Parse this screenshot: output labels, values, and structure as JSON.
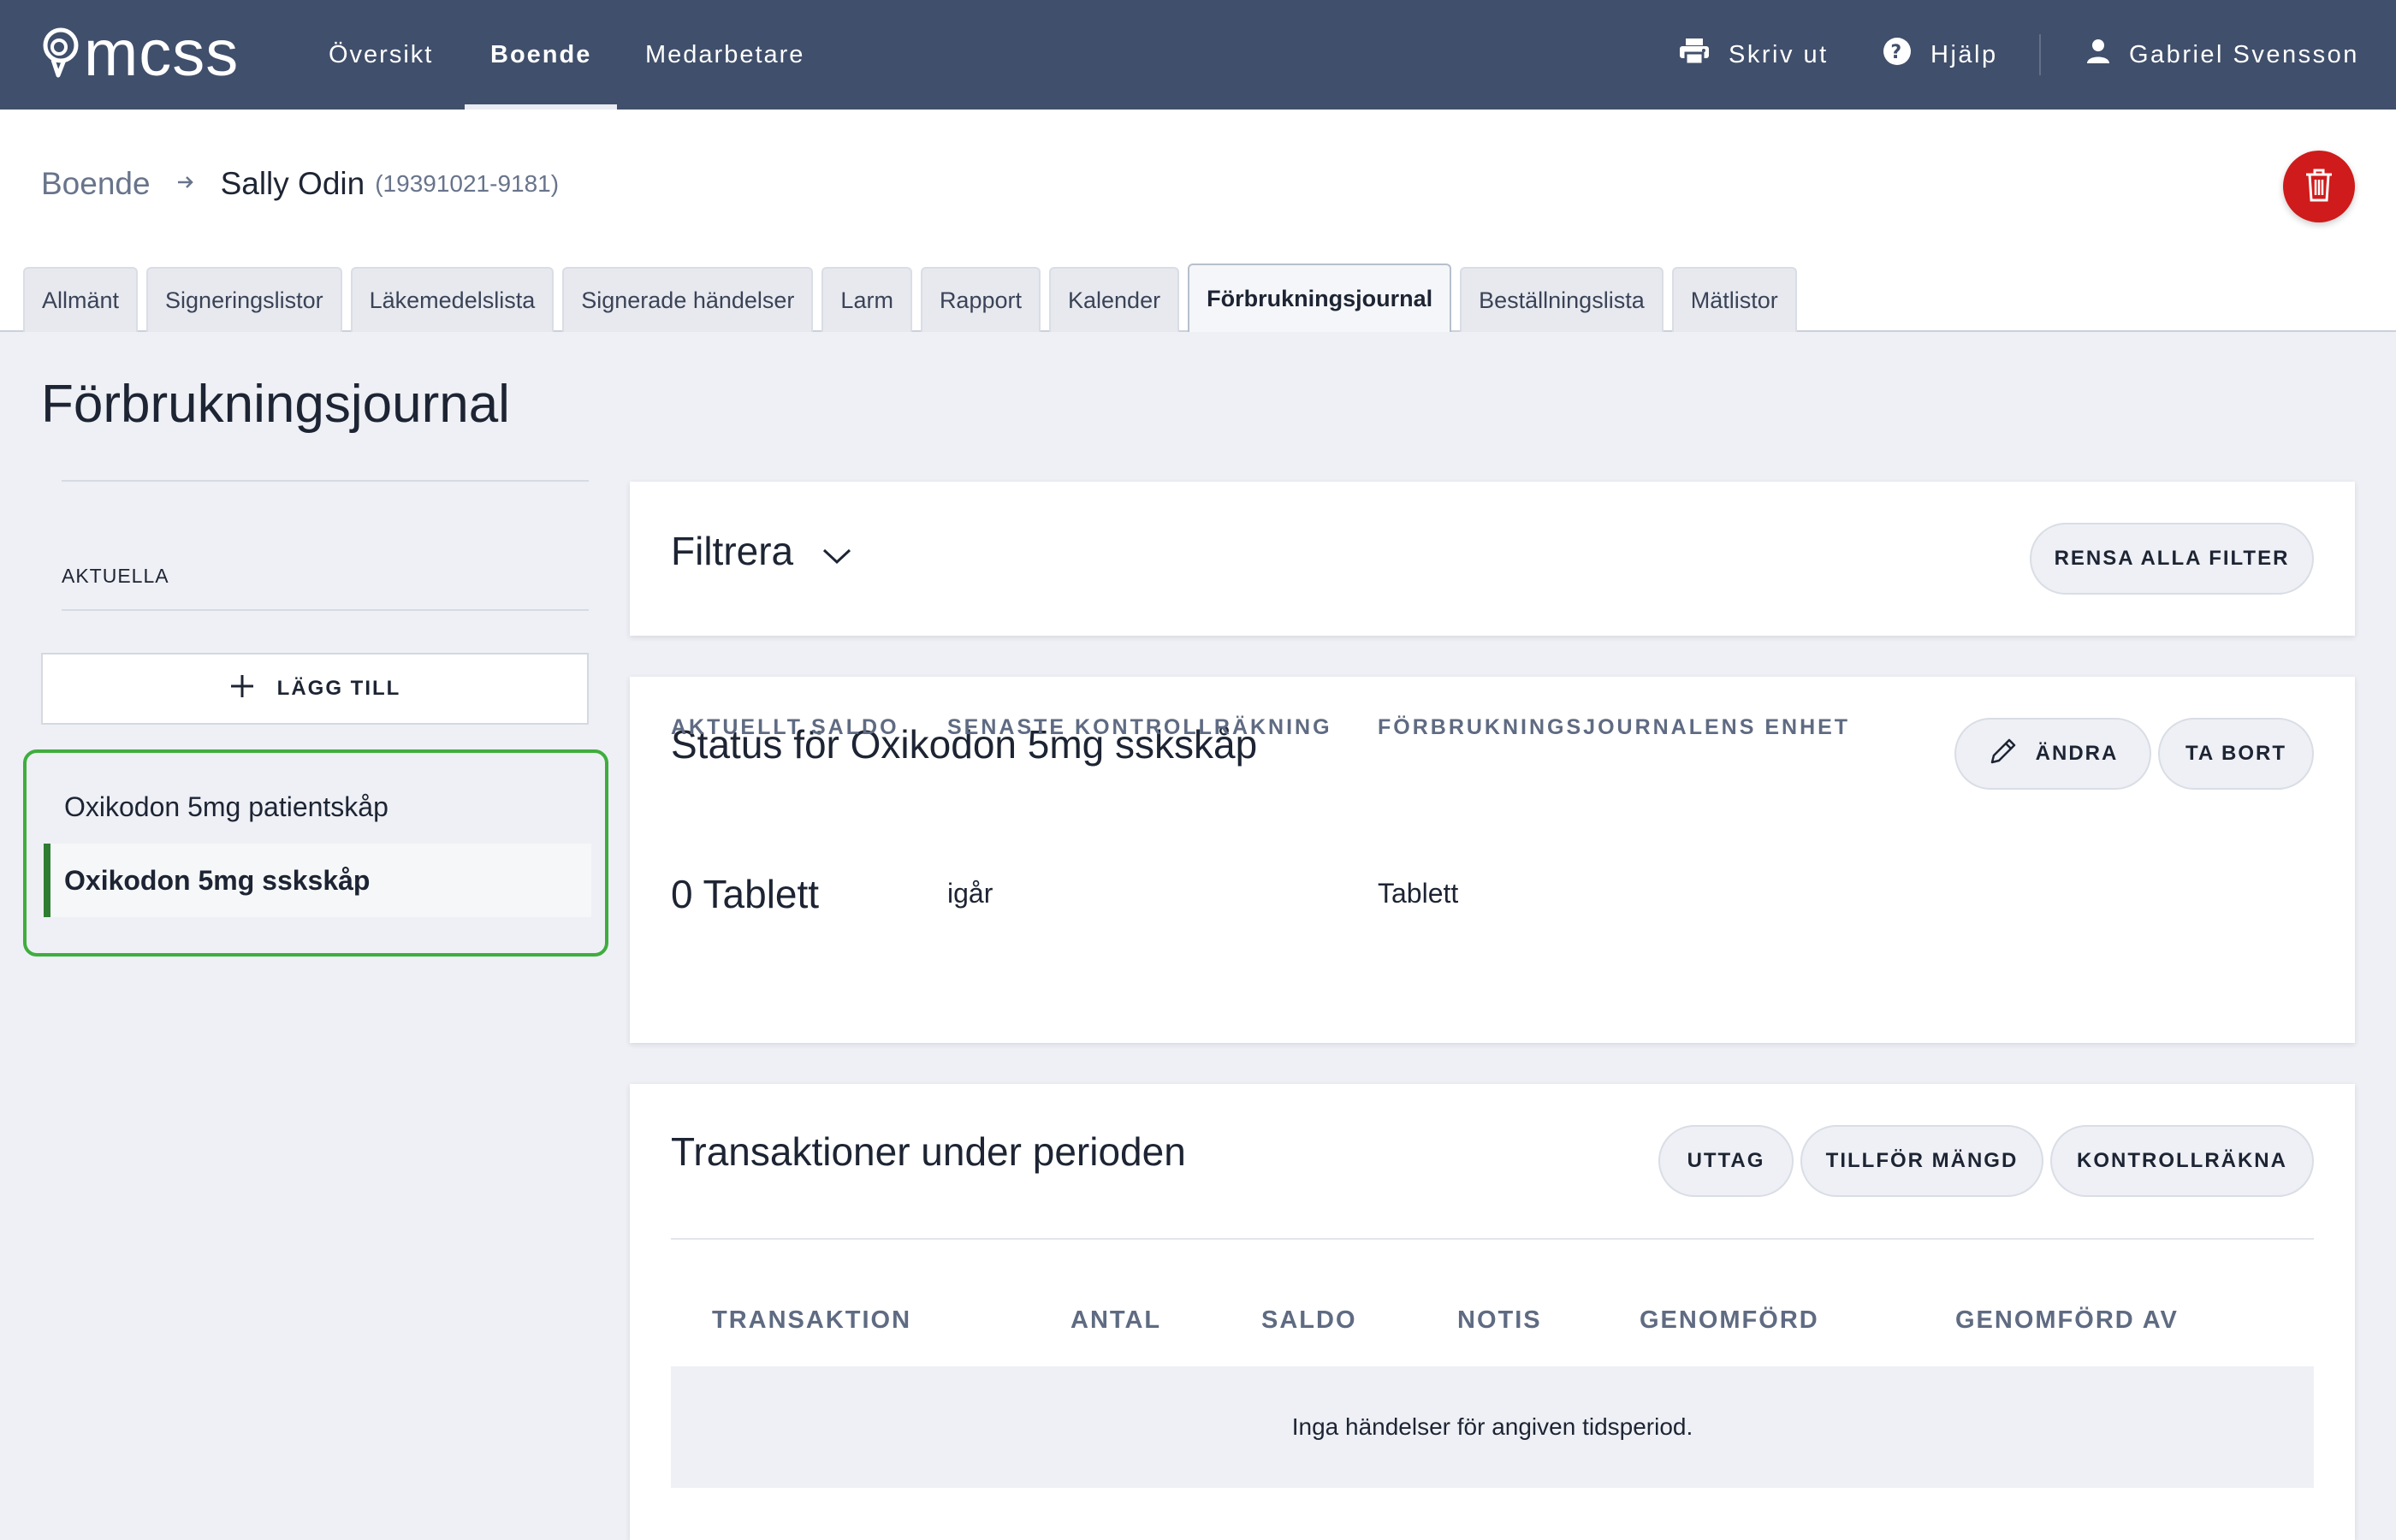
{
  "app": {
    "logo_text": "mcss",
    "nav": [
      "Översikt",
      "Boende",
      "Medarbetare"
    ],
    "nav_active": "Boende",
    "print_label": "Skriv ut",
    "help_label": "Hjälp",
    "user_name": "Gabriel Svensson",
    "colors": {
      "nav_bg": "#404f6b",
      "delete_red": "#cf1b1b",
      "selected_outline": "#3fad3d",
      "selected_bar": "#2e7d32"
    }
  },
  "breadcrumb": {
    "parent": "Boende",
    "current": "Sally Odin",
    "id": "(19391021-9181)"
  },
  "tabs": [
    "Allmänt",
    "Signeringslistor",
    "Läkemedelslista",
    "Signerade händelser",
    "Larm",
    "Rapport",
    "Kalender",
    "Förbrukningsjournal",
    "Beställningslista",
    "Mätlistor"
  ],
  "active_tab": "Förbrukningsjournal",
  "page_title": "Förbrukningsjournal",
  "sidebar": {
    "section_label": "AKTUELLA",
    "add_label": "LÄGG TILL",
    "items": [
      "Oxikodon 5mg patientskåp",
      "Oxikodon 5mg sskskåp"
    ],
    "selected": "Oxikodon 5mg sskskåp"
  },
  "filter": {
    "title": "Filtrera",
    "clear_label": "RENSA ALLA FILTER"
  },
  "status": {
    "title": "Status för Oxikodon 5mg sskskåp",
    "edit_label": "ÄNDRA",
    "remove_label": "TA BORT",
    "balance_label": "AKTUELLT SALDO",
    "balance_value": "0 Tablett",
    "last_count_label": "SENASTE KONTROLLRÄKNING",
    "last_count_value": "igår",
    "unit_label": "FÖRBRUKNINGSJOURNALENS ENHET",
    "unit_value": "Tablett"
  },
  "transactions": {
    "title": "Transaktioner under perioden",
    "withdraw_label": "UTTAG",
    "add_amount_label": "TILLFÖR MÄNGD",
    "count_label": "KONTROLLRÄKNA",
    "columns": [
      "TRANSAKTION",
      "ANTAL",
      "SALDO",
      "NOTIS",
      "GENOMFÖRD",
      "GENOMFÖRD AV"
    ],
    "empty_text": "Inga händelser för angiven tidsperiod."
  },
  "icons": [
    "logo-icon",
    "printer-icon",
    "help-icon",
    "user-icon",
    "arrow-right-icon",
    "trash-icon",
    "plus-icon",
    "chevron-down-icon",
    "pencil-icon"
  ]
}
